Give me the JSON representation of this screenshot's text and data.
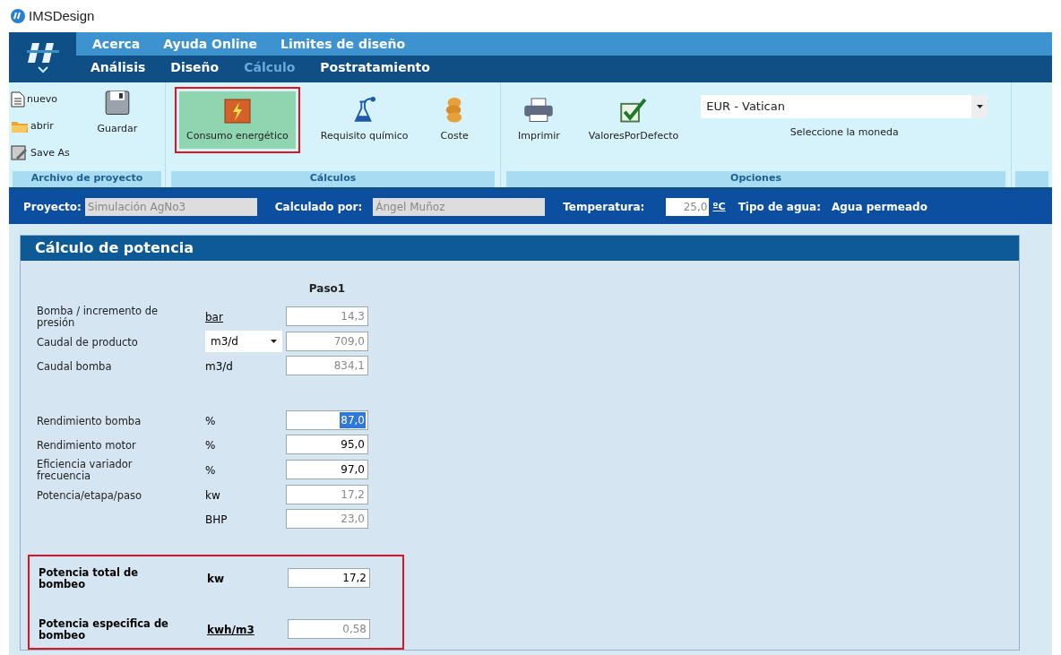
{
  "window": {
    "title": "IMSDesign"
  },
  "menu_top": [
    "Acerca",
    "Ayuda Online",
    "Limites de diseño"
  ],
  "tabs": [
    {
      "label": "Análisis",
      "selected": false
    },
    {
      "label": "Diseño",
      "selected": false
    },
    {
      "label": "Cálculo",
      "selected": true
    },
    {
      "label": "Postratamiento",
      "selected": false
    }
  ],
  "ribbon": {
    "groups": [
      {
        "label": "Archivo de proyecto",
        "small_buttons": [
          {
            "label": "nuevo",
            "kind": "document"
          },
          {
            "label": "abrir",
            "kind": "folder"
          },
          {
            "label": "Save As",
            "kind": "saveas"
          }
        ],
        "buttons": [
          {
            "label": "Guardar",
            "kind": "floppy",
            "selected": false,
            "highlighted": false
          }
        ]
      },
      {
        "label": "Cálculos",
        "buttons": [
          {
            "label": "Consumo energético",
            "kind": "lightning",
            "selected": true,
            "highlighted": true
          },
          {
            "label": "Requisito químico",
            "kind": "flask",
            "selected": false,
            "highlighted": false
          },
          {
            "label": "Coste",
            "kind": "coins",
            "selected": false,
            "highlighted": false
          }
        ]
      },
      {
        "label": "Opciones",
        "buttons": [
          {
            "label": "Imprimir",
            "kind": "printer",
            "selected": false,
            "highlighted": false
          },
          {
            "label": "ValoresPorDefecto",
            "kind": "checkbox",
            "selected": false,
            "highlighted": false
          }
        ],
        "currency": {
          "value": "EUR - Vatican",
          "label": "Seleccione la moneda"
        }
      }
    ]
  },
  "project_bar": {
    "project_label": "Proyecto:",
    "project": "Simulación AgNo3",
    "calc_label": "Calculado por:",
    "calc_by": "Ángel Muñoz",
    "temp_label": "Temperatura:",
    "temp": "25,0",
    "temp_unit": "ºC",
    "water_label": "Tipo de agua:",
    "water": "Agua permeado"
  },
  "panel": {
    "title": "Cálculo de potencia",
    "column": "Paso1",
    "flow_rows": [
      {
        "label": "Bomba / incremento de presión",
        "unit": "bar",
        "kind": "link",
        "value": "14,3",
        "editable": false,
        "highlighted": false
      },
      {
        "label": "Caudal de producto",
        "unit": "m3/d",
        "kind": "dropdown",
        "value": "709,0",
        "editable": false,
        "highlighted": false
      },
      {
        "label": "Caudal bomba",
        "unit": "m3/d",
        "kind": "plain",
        "value": "834,1",
        "editable": false,
        "highlighted": false
      }
    ],
    "efficiency_rows": [
      {
        "label": "Rendimiento bomba",
        "unit": "%",
        "kind": "plain",
        "value": "87,0",
        "editable": true,
        "highlighted": true
      },
      {
        "label": "Rendimiento motor",
        "unit": "%",
        "kind": "plain",
        "value": "95,0",
        "editable": true,
        "highlighted": false
      },
      {
        "label": "Eficiencia variador frecuencia",
        "unit": "%",
        "kind": "plain",
        "value": "97,0",
        "editable": true,
        "highlighted": false
      },
      {
        "label": "Potencia/etapa/paso",
        "unit": "kw",
        "kind": "plain",
        "value": "17,2",
        "editable": false,
        "highlighted": false
      },
      {
        "unit": "BHP",
        "kind": "plain",
        "value": "23,0",
        "editable": false,
        "highlighted": false
      }
    ],
    "totals": [
      {
        "label": "Potencia total de bombeo",
        "unit": "kw",
        "kind": "plain",
        "value": "17,2",
        "editable": true,
        "highlighted": false
      },
      {
        "label": "Potencia especifica de bombeo",
        "unit": "kwh/m3",
        "kind": "link",
        "value": "0,58",
        "editable": false,
        "highlighted": false
      }
    ],
    "totals_highlighted": true
  }
}
